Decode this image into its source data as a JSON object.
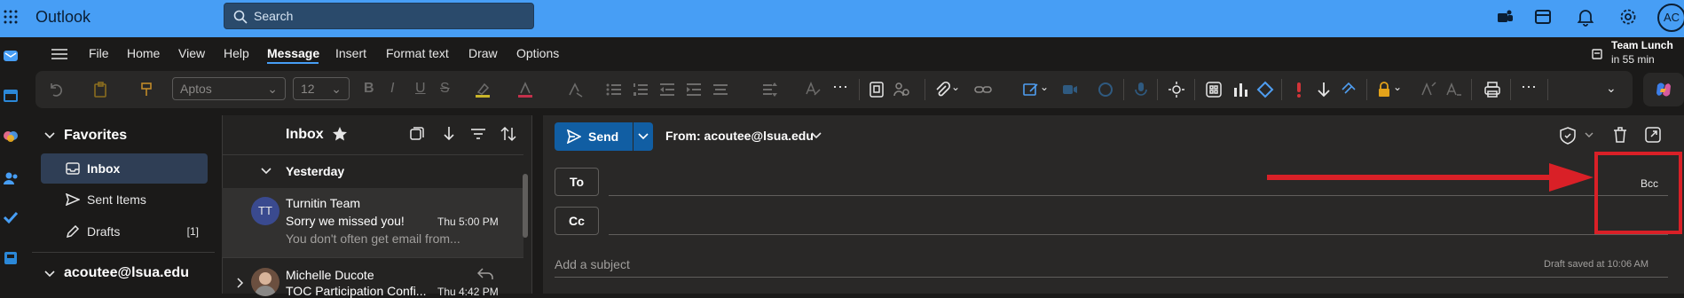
{
  "app": {
    "title": "Outlook",
    "avatar_initials": "AC"
  },
  "search": {
    "placeholder": "Search"
  },
  "menu": [
    "File",
    "Home",
    "View",
    "Help",
    "Message",
    "Insert",
    "Format text",
    "Draw",
    "Options"
  ],
  "menu_active": "Message",
  "reminder": {
    "title": "Team Lunch",
    "subtitle": "in 55 min"
  },
  "toolbar": {
    "font_name": "Aptos",
    "font_size": "12"
  },
  "favorites": {
    "title": "Favorites",
    "items": [
      {
        "label": "Inbox",
        "count": ""
      },
      {
        "label": "Sent Items",
        "count": ""
      },
      {
        "label": "Drafts",
        "count": "[1]"
      }
    ]
  },
  "account": "acoutee@lsua.edu",
  "message_list": {
    "title": "Inbox",
    "group": "Yesterday",
    "messages": [
      {
        "initials": "TT",
        "from": "Turnitin Team",
        "subject": "Sorry we missed you!",
        "time": "Thu 5:00 PM",
        "preview": "You don't often get email from..."
      },
      {
        "initials": "",
        "from": "Michelle Ducote",
        "subject": "TOC Participation Confi...",
        "time": "Thu 4:42 PM",
        "preview": ""
      }
    ]
  },
  "compose": {
    "send_label": "Send",
    "from_label": "From: acoutee@lsua.edu",
    "to_label": "To",
    "cc_label": "Cc",
    "bcc_label": "Bcc",
    "subject_placeholder": "Add a subject",
    "draft_status": "Draft saved at 10:06 AM"
  },
  "colors": {
    "brand": "#479ef5",
    "send": "#115ea3",
    "annotation": "#d92027"
  }
}
